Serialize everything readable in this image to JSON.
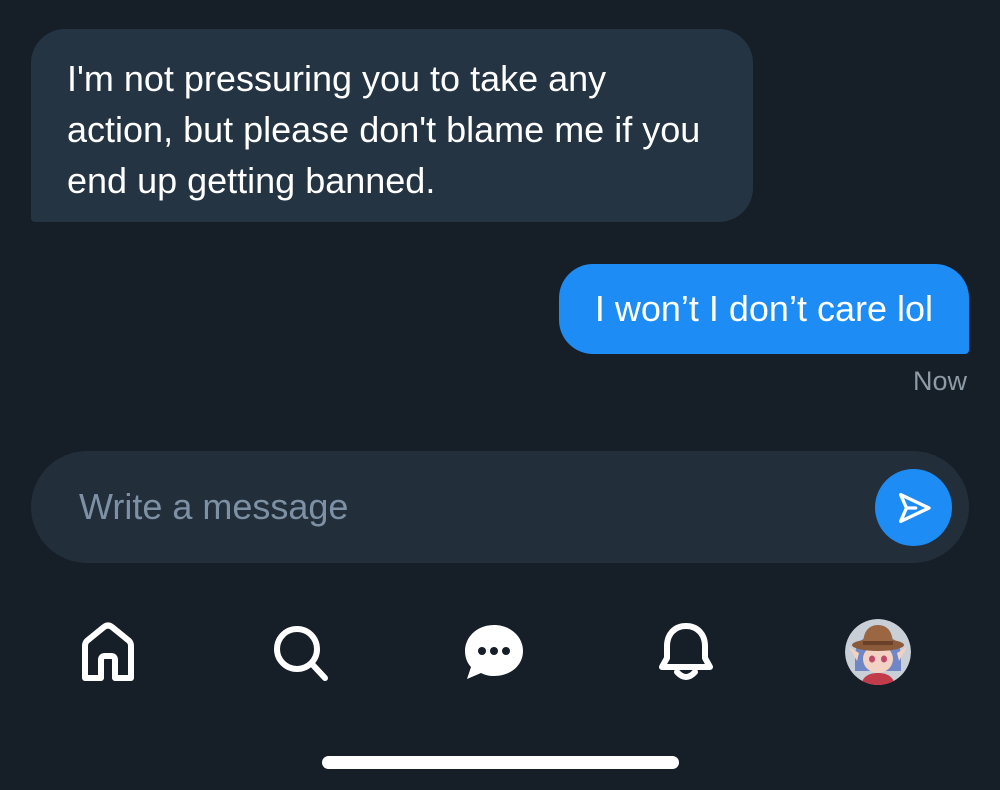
{
  "conversation": {
    "messages": [
      {
        "direction": "received",
        "text": "I'm not pressuring you to take any action, but please don't blame me if you end up getting banned."
      },
      {
        "direction": "sent",
        "text": "I won’t I don’t care lol",
        "timestamp": "Now"
      }
    ]
  },
  "composer": {
    "placeholder": "Write a message",
    "value": "",
    "send_icon": "send-icon"
  },
  "nav": {
    "items": [
      {
        "icon": "home-icon",
        "label": "Home"
      },
      {
        "icon": "search-icon",
        "label": "Search"
      },
      {
        "icon": "messages-icon",
        "label": "Messages"
      },
      {
        "icon": "bell-icon",
        "label": "Notifications"
      },
      {
        "icon": "avatar",
        "label": "Profile"
      }
    ]
  },
  "colors": {
    "background": "#161e27",
    "received_bubble": "#243443",
    "sent_bubble": "#1d8cf5",
    "composer": "#222f3b",
    "placeholder": "#7d90a4",
    "timestamp": "#8e9aa6"
  }
}
